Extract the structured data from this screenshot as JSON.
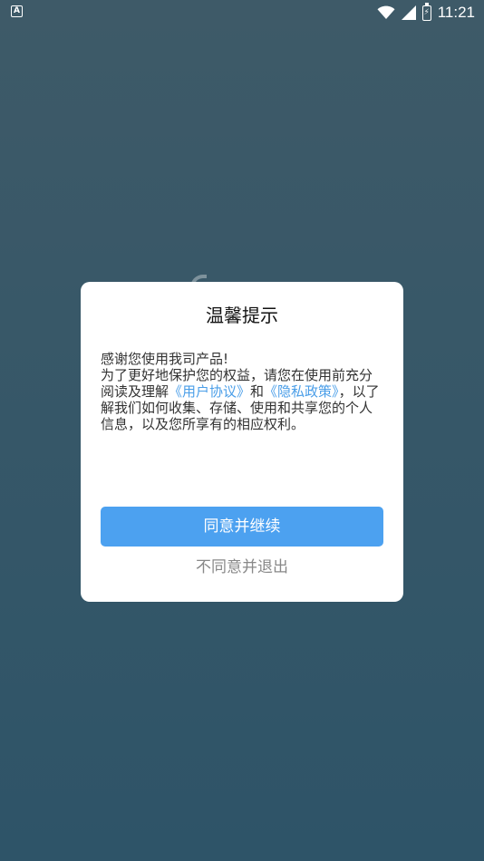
{
  "status_bar": {
    "app_icon_letter": "A",
    "time": "11:21",
    "icons": [
      "wifi-icon",
      "signal-icon",
      "battery-charging-icon"
    ]
  },
  "dialog": {
    "title": "温馨提示",
    "body": {
      "line1": "感谢您使用我司产品!",
      "line2_prefix": "为了更好地保护您的权益，请您在使用前充分阅读及理解",
      "user_agreement_link": "《用户协议》",
      "connector": "和",
      "privacy_policy_link": "《隐私政策》",
      "line2_suffix": "，以了解我们如何收集、存储、使用和共享您的个人信息，以及您所享有的相应权利。"
    },
    "agree_button": "同意并继续",
    "disagree_button": "不同意并退出"
  },
  "colors": {
    "background_top": "#3e5a68",
    "background_bottom": "#2e5468",
    "primary_button": "#4ca1f0",
    "link": "#4a9ee8",
    "secondary_text": "#888888"
  }
}
